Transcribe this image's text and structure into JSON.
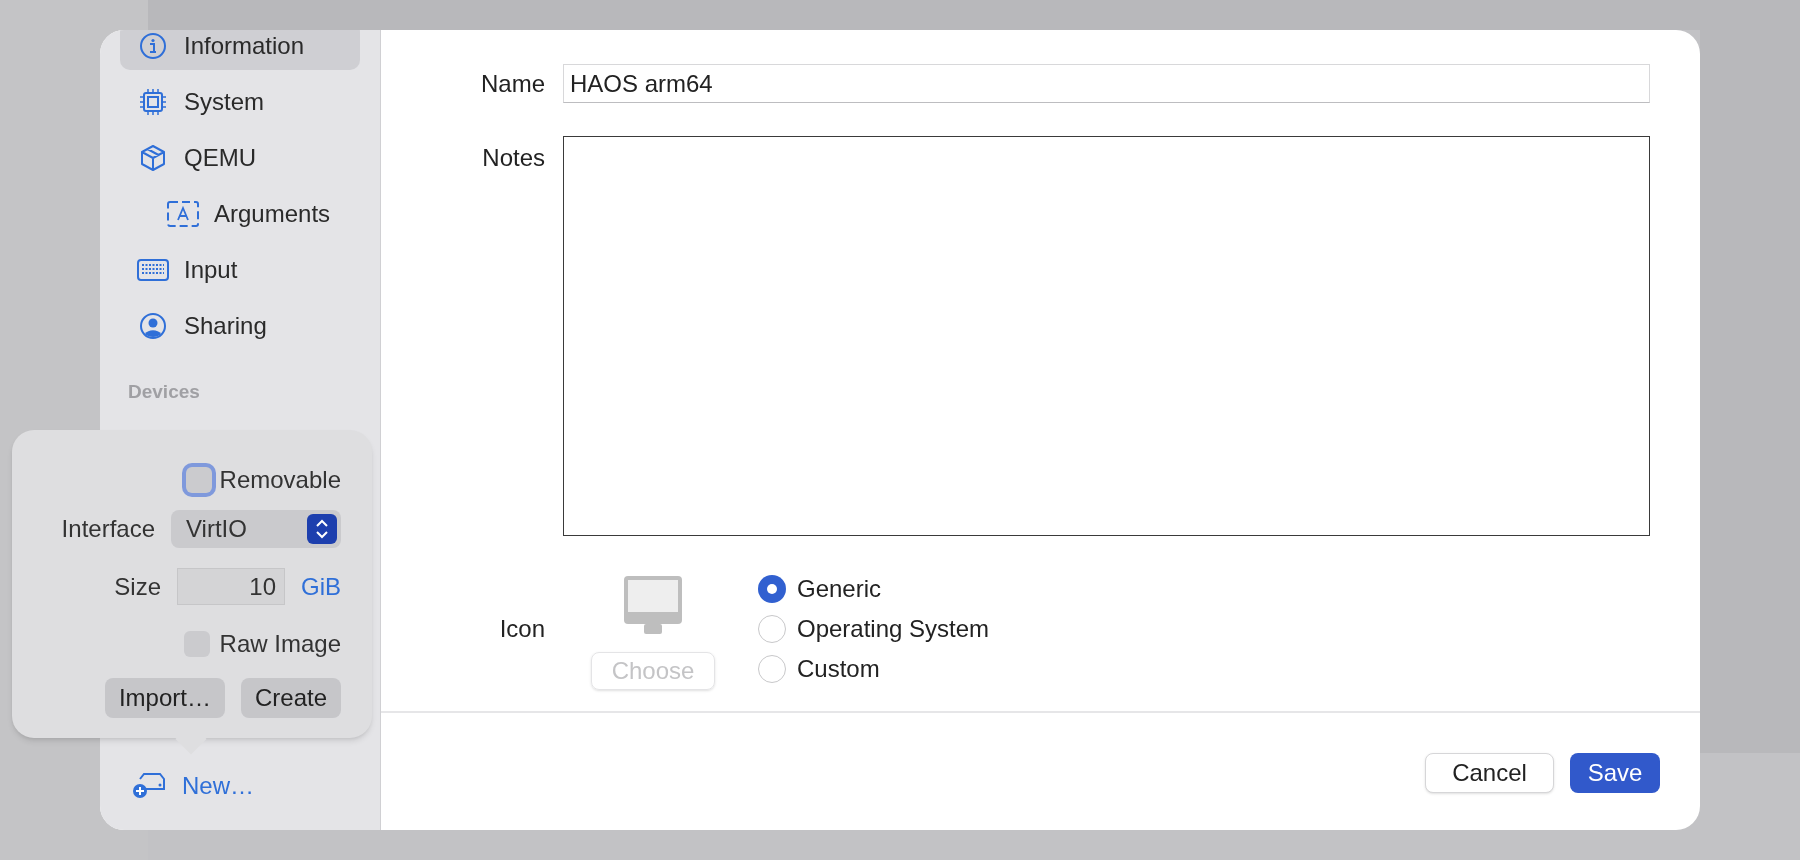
{
  "sidebar": {
    "items": [
      {
        "label": "Information",
        "selected": true
      },
      {
        "label": "System",
        "selected": false
      },
      {
        "label": "QEMU",
        "selected": false,
        "children": [
          {
            "label": "Arguments",
            "selected": false
          }
        ]
      },
      {
        "label": "Input",
        "selected": false
      },
      {
        "label": "Sharing",
        "selected": false
      }
    ],
    "section_heading": "Devices",
    "new_button": "New…"
  },
  "popover": {
    "removable": {
      "label": "Removable",
      "checked": false,
      "focused": true
    },
    "interface": {
      "label": "Interface",
      "value": "VirtIO"
    },
    "size": {
      "label": "Size",
      "value": "10",
      "unit": "GiB"
    },
    "raw_image": {
      "label": "Raw Image",
      "checked": false
    },
    "buttons": [
      "Import…",
      "Create"
    ]
  },
  "form": {
    "name": {
      "label": "Name",
      "value": "HAOS arm64"
    },
    "notes": {
      "label": "Notes"
    },
    "icon": {
      "label": "Icon",
      "choose_button": {
        "label": "Choose",
        "disabled": true
      },
      "options": [
        {
          "label": "Generic",
          "selected": true
        },
        {
          "label": "Operating System",
          "selected": false
        },
        {
          "label": "Custom",
          "selected": false
        }
      ]
    }
  },
  "footer": {
    "buttons": [
      {
        "label": "Cancel",
        "kind": "secondary"
      },
      {
        "label": "Save",
        "kind": "primary"
      }
    ]
  }
}
